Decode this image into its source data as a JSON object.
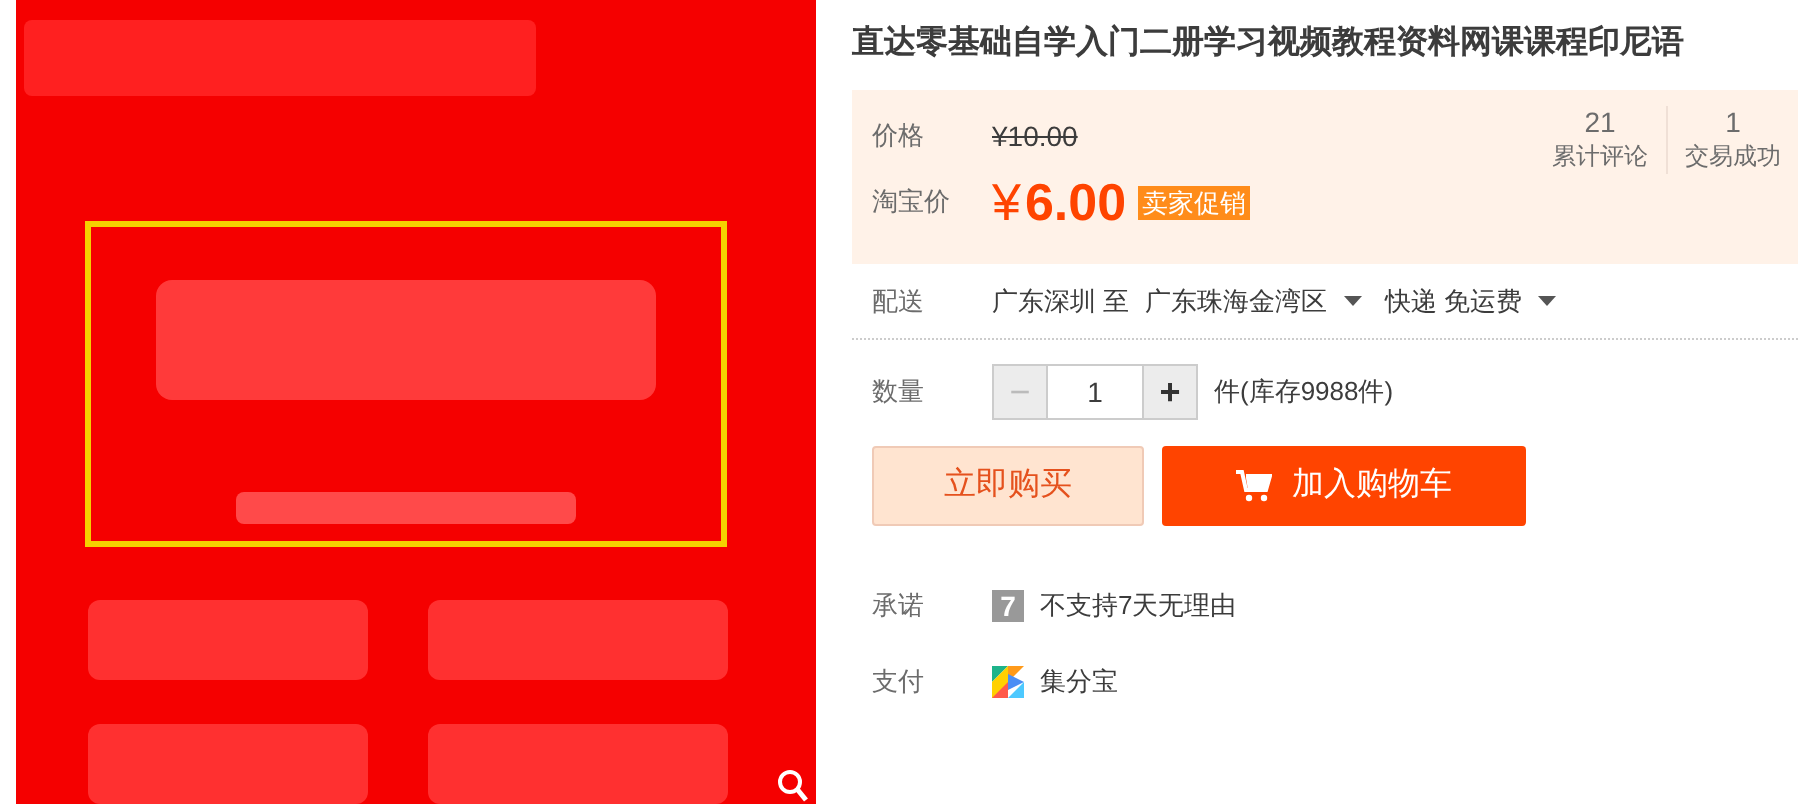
{
  "title": "直达零基础自学入门二册学习视频教程资料网课课程印尼语",
  "price": {
    "label": "价格",
    "original": "¥10.00",
    "promo_label": "淘宝价",
    "currency": "¥",
    "promo": "6.00",
    "badge": "卖家促销"
  },
  "stats": [
    {
      "value": "21",
      "label": "累计评论"
    },
    {
      "value": "1",
      "label": "交易成功"
    }
  ],
  "delivery": {
    "label": "配送",
    "from": "广东深圳 至",
    "to": "广东珠海金湾区",
    "shipping": "快递 免运费"
  },
  "quantity": {
    "label": "数量",
    "minus": "−",
    "value": "1",
    "plus": "+",
    "stock": "件(库存9988件)"
  },
  "buttons": [
    "立即购买",
    "加入购物车"
  ],
  "promise": {
    "label": "承诺",
    "badge": "7",
    "text": "不支持7天无理由"
  },
  "payment": {
    "label": "支付",
    "text": "集分宝"
  }
}
